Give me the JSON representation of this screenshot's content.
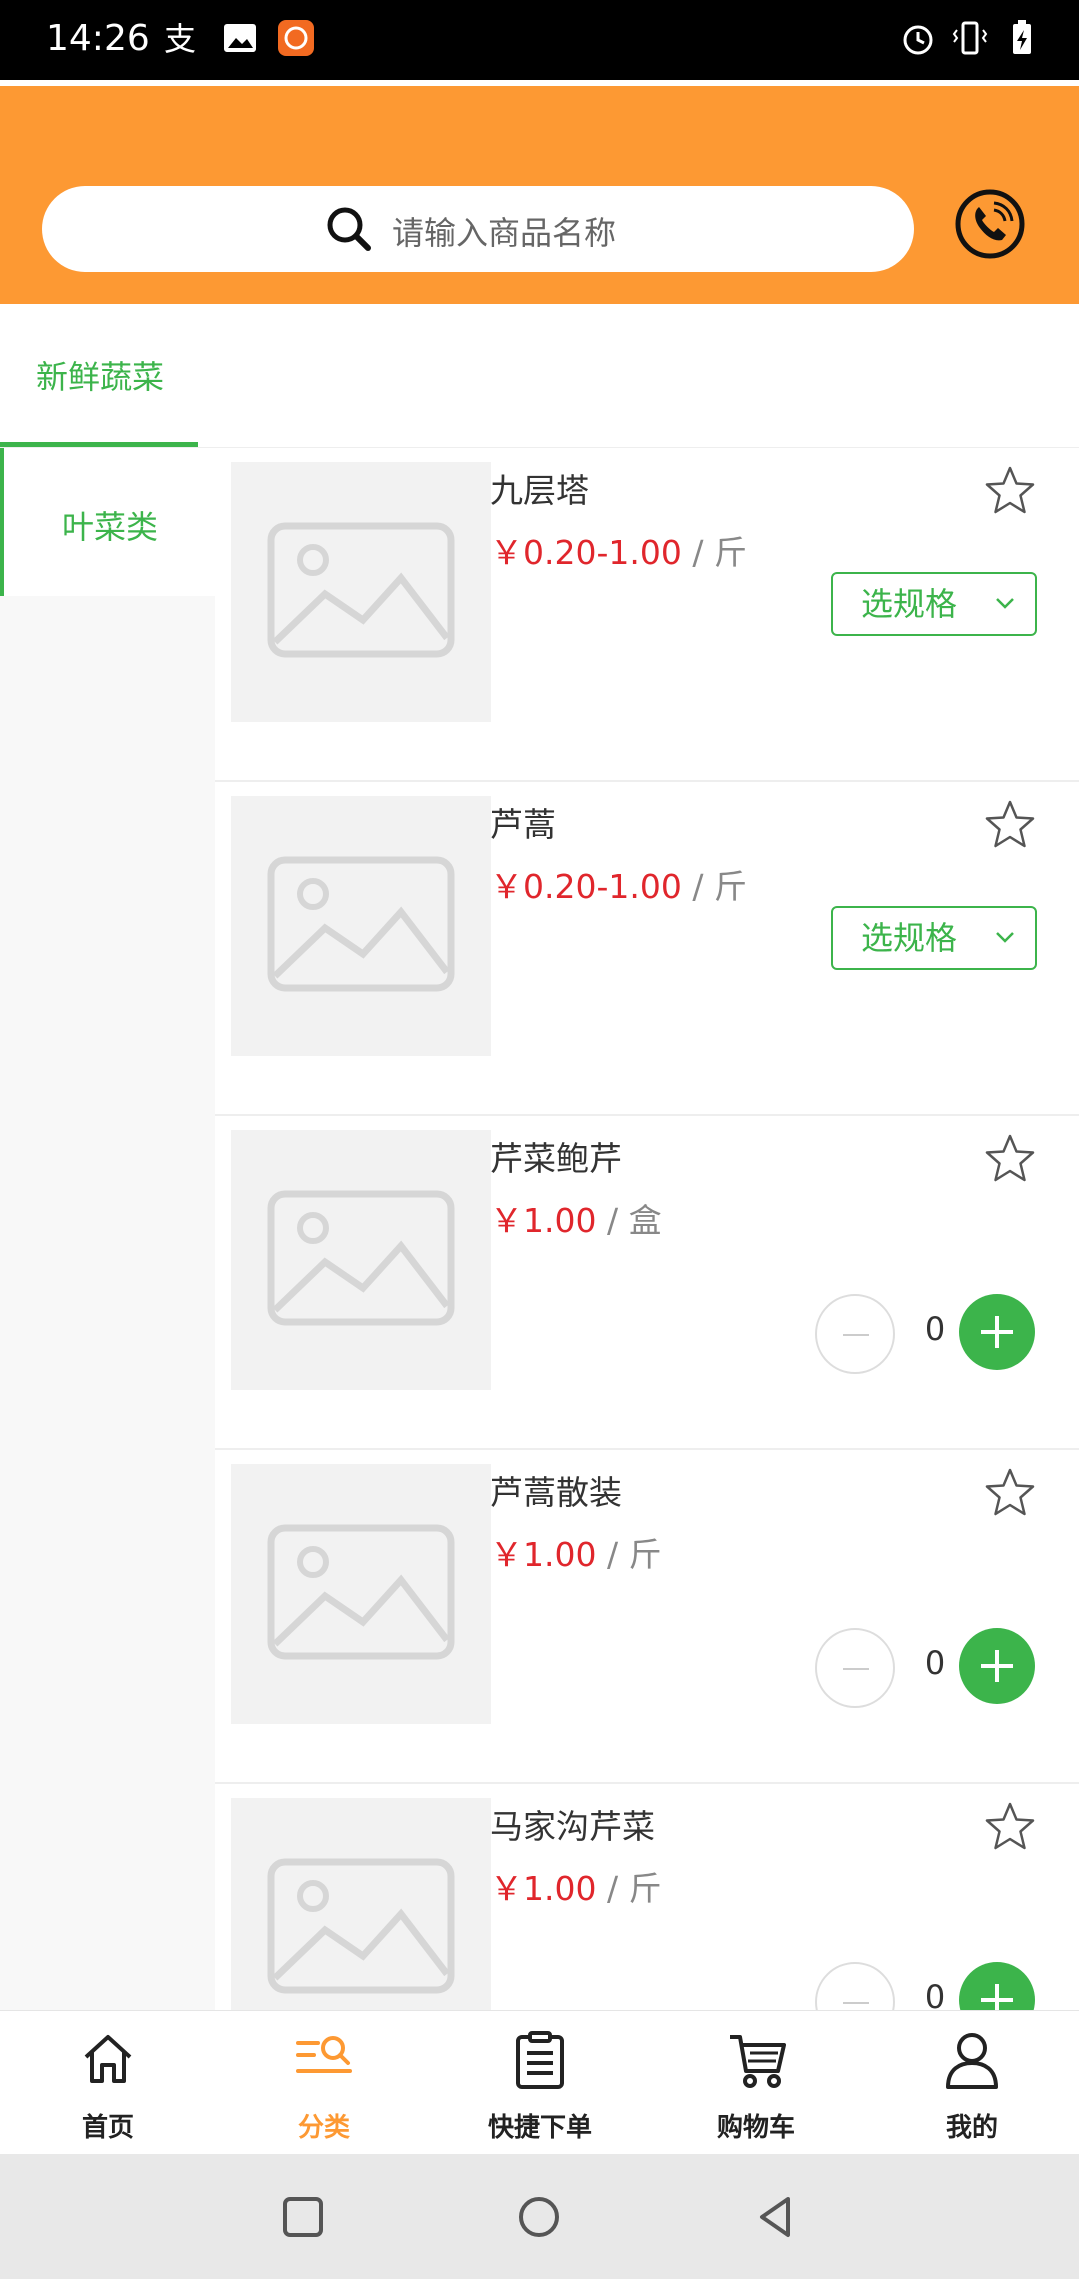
{
  "status_bar": {
    "time": "14:26"
  },
  "search": {
    "placeholder": "请输入商品名称"
  },
  "category_top": {
    "label": "新鲜蔬菜"
  },
  "sidebar": {
    "items": [
      {
        "label": "叶菜类"
      }
    ]
  },
  "products": [
    {
      "name": "九层塔",
      "price": "￥0.20-1.00",
      "unit": "/ 斤",
      "action": "spec",
      "spec_label": "选规格"
    },
    {
      "name": "芦蒿",
      "price": "￥0.20-1.00",
      "unit": "/ 斤",
      "action": "spec",
      "spec_label": "选规格"
    },
    {
      "name": "芹菜鲍芹",
      "price": "￥1.00",
      "unit": "/ 盒",
      "action": "stepper",
      "qty": "0"
    },
    {
      "name": "芦蒿散装",
      "price": "￥1.00",
      "unit": "/ 斤",
      "action": "stepper",
      "qty": "0"
    },
    {
      "name": "马家沟芹菜",
      "price": "￥1.00",
      "unit": "/ 斤",
      "action": "stepper",
      "qty": "0"
    }
  ],
  "tabbar": {
    "items": [
      {
        "label": "首页",
        "icon": "home-icon"
      },
      {
        "label": "分类",
        "icon": "category-search-icon",
        "active": true
      },
      {
        "label": "快捷下单",
        "icon": "clipboard-icon"
      },
      {
        "label": "购物车",
        "icon": "cart-icon"
      },
      {
        "label": "我的",
        "icon": "user-icon"
      }
    ]
  },
  "colors": {
    "brand_orange": "#fd9933",
    "accent_green": "#3cb44b",
    "price_red": "#e0262c"
  }
}
